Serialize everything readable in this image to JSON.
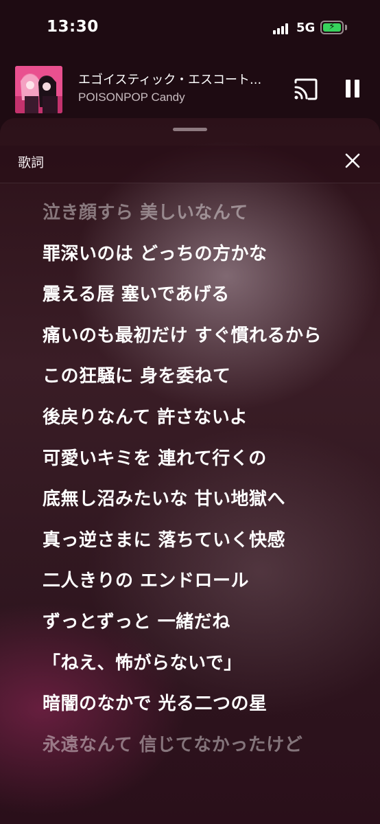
{
  "status_bar": {
    "time": "13:30",
    "network": "5G",
    "battery_state": "charging",
    "battery_color": "#37d35c"
  },
  "now_playing": {
    "title": "エゴイスティック・エスコート...",
    "artist": "POISONPOP Candy",
    "cast_icon": "cast-icon",
    "pause_icon": "pause-icon"
  },
  "sheet": {
    "title": "歌詞",
    "close_icon": "close-icon"
  },
  "lyrics": [
    {
      "text": "泣き顔すら 美しいなんて",
      "state": "past"
    },
    {
      "text": "罪深いのは どっちの方かな",
      "state": "current"
    },
    {
      "text": "震える唇 塞いであげる",
      "state": "current"
    },
    {
      "text": "痛いのも最初だけ すぐ慣れるから",
      "state": "current"
    },
    {
      "text": "この狂騒に 身を委ねて",
      "state": "current"
    },
    {
      "text": "後戻りなんて 許さないよ",
      "state": "current"
    },
    {
      "text": "可愛いキミを 連れて行くの",
      "state": "current"
    },
    {
      "text": "底無し沼みたいな 甘い地獄へ",
      "state": "current"
    },
    {
      "text": "真っ逆さまに 落ちていく快感",
      "state": "current"
    },
    {
      "text": "二人きりの エンドロール",
      "state": "current"
    },
    {
      "text": "ずっとずっと 一緒だね",
      "state": "current"
    },
    {
      "text": "「ねえ、怖がらないで」",
      "state": "current"
    },
    {
      "text": "暗闇のなかで 光る二つの星",
      "state": "current"
    },
    {
      "text": "永遠なんて 信じてなかったけど",
      "state": "upcoming"
    }
  ]
}
